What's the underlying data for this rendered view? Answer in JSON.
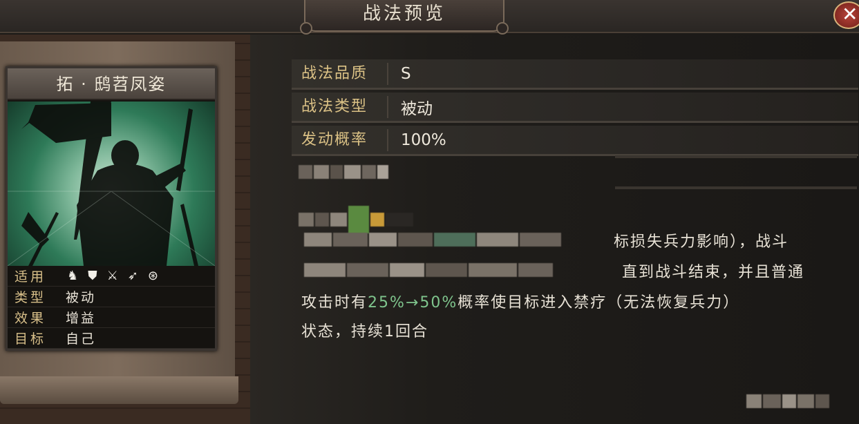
{
  "header": {
    "title": "战法预览",
    "close_icon": "close-icon"
  },
  "card": {
    "name": "拓 · 鸱苕凤姿",
    "attributes": [
      {
        "key": "适用",
        "icons": [
          "cavalry-icon",
          "shield-icon",
          "crossed-swords-icon",
          "arrow-icon",
          "wheel-icon"
        ]
      },
      {
        "key": "类型",
        "value": "被动"
      },
      {
        "key": "效果",
        "value": "增益"
      },
      {
        "key": "目标",
        "value": "自己"
      }
    ]
  },
  "properties": [
    {
      "label": "战法品质",
      "value": "S"
    },
    {
      "label": "战法类型",
      "value": "被动"
    },
    {
      "label": "发动概率",
      "value": "100%"
    }
  ],
  "description": {
    "line1_visible": "标损失兵力影响），战斗",
    "line2_visible": "直到战斗结束，并且普通",
    "line3_pre": "攻击时有",
    "line3_highlight": "25%→50%",
    "line3_post": "概率使目标进入禁疗（无法恢复兵力）",
    "line4": "状态，持续1回合"
  },
  "colors": {
    "label_gold": "#dcc286",
    "highlight_green": "#7fc58d",
    "close_red": "#b8443a"
  }
}
